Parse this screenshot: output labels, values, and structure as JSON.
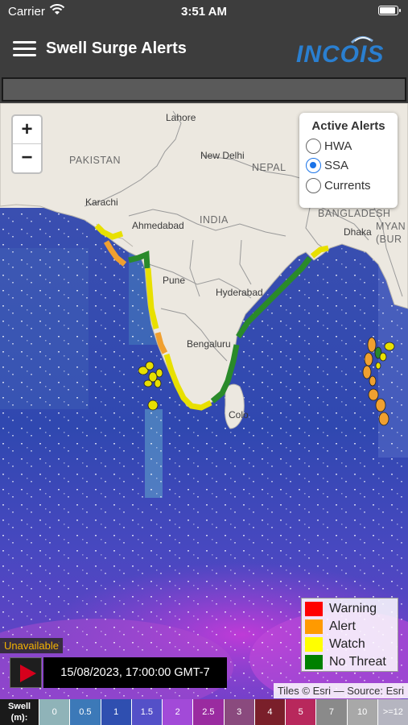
{
  "status_bar": {
    "carrier": "Carrier",
    "time": "3:51 AM"
  },
  "app_bar": {
    "title": "Swell Surge Alerts",
    "logo_text": "INCOIS"
  },
  "map": {
    "country_labels": [
      "PAKISTAN",
      "NEPAL",
      "INDIA",
      "BANGLADESH",
      "MYAN (BUR"
    ],
    "city_labels": [
      "Lahore",
      "New Delhi",
      "Karachi",
      "Ahmedabad",
      "Dhaka",
      "Pune",
      "Hyderabad",
      "Bengaluru",
      "Colo"
    ],
    "zoom_in": "+",
    "zoom_out": "−"
  },
  "active_alerts": {
    "title": "Active Alerts",
    "options": [
      {
        "label": "HWA",
        "checked": false
      },
      {
        "label": "SSA",
        "checked": true
      },
      {
        "label": "Currents",
        "checked": false
      }
    ]
  },
  "legend": [
    {
      "label": "Warning",
      "color": "#ff0000"
    },
    {
      "label": "Alert",
      "color": "#ff9a00"
    },
    {
      "label": "Watch",
      "color": "#ffff00"
    },
    {
      "label": "No Threat",
      "color": "#008000"
    }
  ],
  "player": {
    "unavailable": "Unavailable",
    "datetime": "15/08/2023, 17:00:00 GMT-7"
  },
  "attribution": "Tiles © Esri — Source: Esri",
  "swell_scale": {
    "title_line1": "Swell",
    "title_line2": "(m):",
    "cells": [
      {
        "label": "0",
        "color": "#8fb3b8"
      },
      {
        "label": "0.5",
        "color": "#3c79b8"
      },
      {
        "label": "1",
        "color": "#2f4fb0"
      },
      {
        "label": "1.5",
        "color": "#5450c8"
      },
      {
        "label": "2",
        "color": "#a24ad8"
      },
      {
        "label": "2.5",
        "color": "#9a2ba0"
      },
      {
        "label": "3",
        "color": "#8a4a7e"
      },
      {
        "label": "4",
        "color": "#7a1f2a"
      },
      {
        "label": "5",
        "color": "#b8285c"
      },
      {
        "label": "7",
        "color": "#8a8a8a"
      },
      {
        "label": "10",
        "color": "#a8a8a8"
      },
      {
        "label": ">=12",
        "color": "#b5b5c0"
      }
    ]
  }
}
